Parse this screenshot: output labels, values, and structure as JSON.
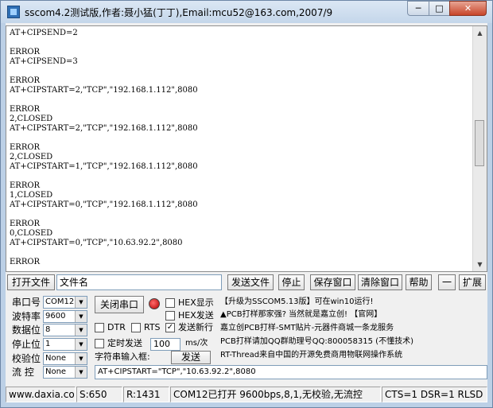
{
  "window": {
    "title": "sscom4.2测试版,作者:聂小猛(丁丁),Email:mcu52@163.com,2007/9",
    "min_glyph": "─",
    "max_glyph": "□",
    "close_glyph": "✕"
  },
  "terminal": {
    "lines": [
      "AT+CIPSEND=2",
      "",
      "ERROR",
      "AT+CIPSEND=3",
      "",
      "ERROR",
      "AT+CIPSTART=2,\"TCP\",\"192.168.1.112\",8080",
      "",
      "ERROR",
      "2,CLOSED",
      "AT+CIPSTART=2,\"TCP\",\"192.168.1.112\",8080",
      "",
      "ERROR",
      "2,CLOSED",
      "AT+CIPSTART=1,\"TCP\",\"192.168.1.112\",8080",
      "",
      "ERROR",
      "1,CLOSED",
      "AT+CIPSTART=0,\"TCP\",\"192.168.1.112\",8080",
      "",
      "ERROR",
      "0,CLOSED",
      "AT+CIPSTART=0,\"TCP\",\"10.63.92.2\",8080",
      "",
      "ERROR"
    ]
  },
  "toolbar": {
    "open_file": "打开文件",
    "filename": "文件名",
    "send_file": "发送文件",
    "stop": "停止",
    "save_window": "保存窗口",
    "clear_window": "清除窗口",
    "help": "帮助",
    "collapse": "一",
    "expand": "扩展"
  },
  "settings": {
    "port_label": "串口号",
    "port_value": "COM12",
    "baud_label": "波特率",
    "baud_value": "9600",
    "databits_label": "数据位",
    "databits_value": "8",
    "stopbits_label": "停止位",
    "stopbits_value": "1",
    "parity_label": "校验位",
    "parity_value": "None",
    "flow_label": "流 控",
    "flow_value": "None",
    "close_port": "关闭串口",
    "hex_display": "HEX显示",
    "hex_send": "HEX发送",
    "dtr": "DTR",
    "rts": "RTS",
    "send_newline": "发送新行",
    "timed_send": "定时发送",
    "interval": "100",
    "interval_unit": "ms/次",
    "input_label": "字符串输入框:",
    "send": "发送",
    "input_value": "AT+CIPSTART=\"TCP\",\"10.63.92.2\",8080"
  },
  "ad": {
    "line1": "【升级为SSCOM5.13版】可在win10运行!",
    "line2": "▲PCB打样那家强? 当然就是嘉立创! 【官网】",
    "line3": "嘉立创PCB打样-SMT贴片-元器件商城一条龙服务",
    "line4": "PCB打样请加QQ群助理号QQ:800058315 (不懂技术)",
    "line5": "RT-Thread来自中国的开源免费商用物联网操作系统"
  },
  "status": {
    "site": "www.daxia.com",
    "sent": "S:650",
    "received": "R:1431",
    "port_state": "COM12已打开  9600bps,8,1,无校验,无流控",
    "signals": "CTS=1 DSR=1 RLSD"
  }
}
